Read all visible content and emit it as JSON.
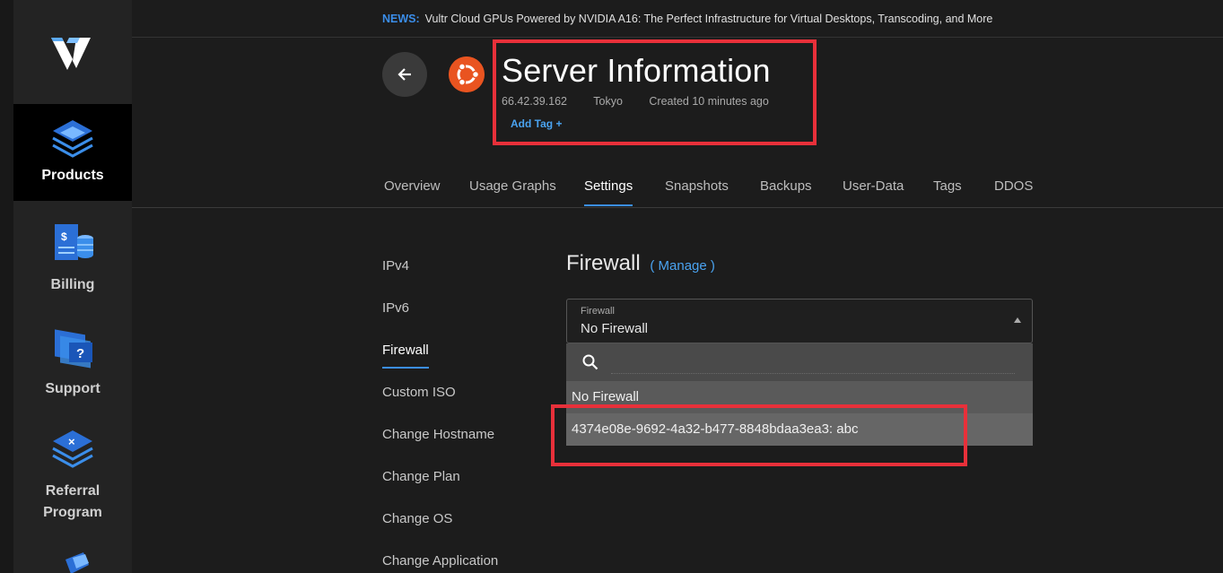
{
  "news": {
    "label": "NEWS:",
    "text": "Vultr Cloud GPUs Powered by NVIDIA A16: The Perfect Infrastructure for Virtual Desktops, Transcoding, and More"
  },
  "sidebar": {
    "items": [
      {
        "label": "Products",
        "icon": "products-icon",
        "active": true
      },
      {
        "label": "Billing",
        "icon": "billing-icon",
        "active": false
      },
      {
        "label": "Support",
        "icon": "support-icon",
        "active": false
      },
      {
        "label": "Referral Program",
        "icon": "referral-icon",
        "active": false
      }
    ]
  },
  "server": {
    "title": "Server Information",
    "ip": "66.42.39.162",
    "location": "Tokyo",
    "created": "Created 10 minutes ago",
    "add_tag": "Add Tag +",
    "os_icon": "ubuntu-icon"
  },
  "tabs": [
    "Overview",
    "Usage Graphs",
    "Settings",
    "Snapshots",
    "Backups",
    "User-Data",
    "Tags",
    "DDOS"
  ],
  "active_tab": "Settings",
  "settings_nav": [
    "IPv4",
    "IPv6",
    "Firewall",
    "Custom ISO",
    "Change Hostname",
    "Change Plan",
    "Change OS",
    "Change Application"
  ],
  "active_setting": "Firewall",
  "firewall": {
    "heading": "Firewall",
    "manage_link": "( Manage )",
    "field_label": "Firewall",
    "selected": "No Firewall",
    "search_placeholder": "",
    "options": [
      "No Firewall",
      "4374e08e-9692-4a32-b477-8848bdaa3ea3: abc"
    ],
    "highlighted_option": "4374e08e-9692-4a32-b477-8848bdaa3ea3: abc"
  },
  "colors": {
    "accent": "#3b8eea",
    "highlight_box": "#e8303a",
    "ubuntu_orange": "#e95420"
  }
}
